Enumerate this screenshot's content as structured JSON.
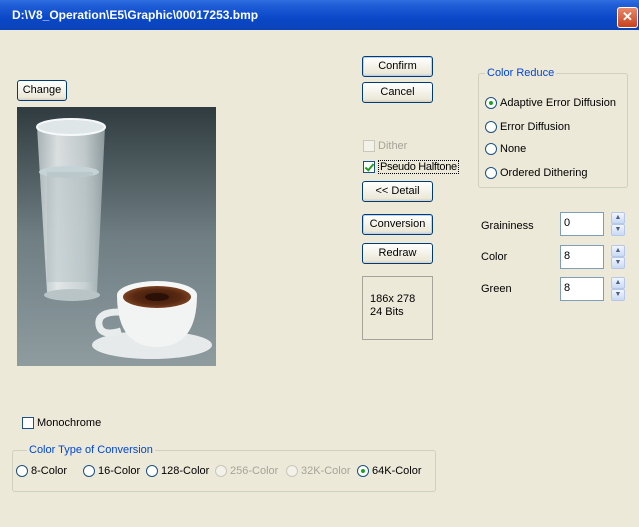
{
  "window": {
    "title": "D:\\V8_Operation\\E5\\Graphic\\00017253.bmp",
    "close_glyph": "✕"
  },
  "buttons": {
    "change": "Change",
    "confirm": "Confirm",
    "cancel": "Cancel",
    "detail": "<< Detail",
    "conversion": "Conversion",
    "redraw": "Redraw"
  },
  "options": {
    "dither": {
      "label": "Dither",
      "checked": false,
      "enabled": false
    },
    "pseudo_halftone": {
      "label": "Pseudo Halftone",
      "checked": true,
      "enabled": true
    },
    "monochrome": {
      "label": "Monochrome",
      "checked": false,
      "enabled": true
    }
  },
  "info": {
    "size": "186x 278",
    "bits": "24 Bits"
  },
  "color_reduce": {
    "title": "Color Reduce",
    "items": [
      {
        "label": "Adaptive Error Diffusion",
        "selected": true
      },
      {
        "label": "Error Diffusion",
        "selected": false
      },
      {
        "label": "None",
        "selected": false
      },
      {
        "label": "Ordered Dithering",
        "selected": false
      }
    ]
  },
  "params": {
    "graininess": {
      "label": "Graininess",
      "value": "0"
    },
    "color": {
      "label": "Color",
      "value": "8"
    },
    "green": {
      "label": "Green",
      "value": "8"
    }
  },
  "color_type": {
    "title": "Color Type of Conversion",
    "items": [
      {
        "label": "8-Color",
        "selected": false,
        "enabled": true
      },
      {
        "label": "16-Color",
        "selected": false,
        "enabled": true
      },
      {
        "label": "128-Color",
        "selected": false,
        "enabled": true
      },
      {
        "label": "256-Color",
        "selected": false,
        "enabled": false
      },
      {
        "label": "32K-Color",
        "selected": false,
        "enabled": false
      },
      {
        "label": "64K-Color",
        "selected": true,
        "enabled": true
      }
    ]
  }
}
